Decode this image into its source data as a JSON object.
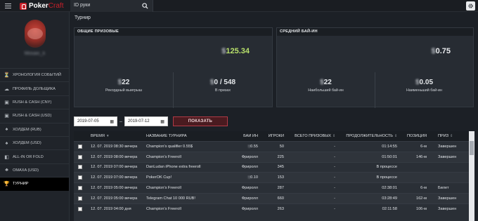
{
  "app": {
    "name_a": "Poker",
    "name_b": "Craft"
  },
  "search": {
    "value": "ID руки"
  },
  "user": {
    "name": "Mosaic_k"
  },
  "sidebar": {
    "items": [
      {
        "label": "ХРОНОЛОГИЯ СОБЫТИЙ",
        "icon": "timeline-icon"
      },
      {
        "label": "ПРОФИЛЬ ДОЛЬЩИКА",
        "icon": "cloud-icon"
      },
      {
        "label": "RUSH & CASH (CNY)",
        "icon": "rush-icon"
      },
      {
        "label": "RUSH & CASH (USD)",
        "icon": "rush-icon"
      },
      {
        "label": "ХОЛДЕМ (RUB)",
        "icon": "cards-icon"
      },
      {
        "label": "ХОЛДЕМ (USD)",
        "icon": "cards-icon"
      },
      {
        "label": "ALL-IN OR FOLD",
        "icon": "allin-icon"
      },
      {
        "label": "OMAXA (USD)",
        "icon": "omaha-icon"
      },
      {
        "label": "ТУРНИР",
        "icon": "trophy-icon"
      }
    ]
  },
  "page": {
    "title": "Турнир"
  },
  "prize_panel": {
    "title": "ОБЩИЕ ПРИЗОВЫЕ",
    "value": "125.34",
    "stats": [
      {
        "value": "22",
        "label": "Рекордный выигрыш"
      },
      {
        "value": "0 / 548",
        "label": "В призах"
      }
    ]
  },
  "buyin_panel": {
    "title": "СРЕДНИЙ БАЙ-ИН",
    "value": "0.75",
    "stats": [
      {
        "value": "22",
        "label": "Наибольший бай-ин"
      },
      {
        "value": "0.05",
        "label": "Наименьший бай-ин"
      }
    ]
  },
  "filters": {
    "date_from": "2019-07-05",
    "date_to": "2019-07-12",
    "separator": "–",
    "show_label": "ПОКАЗАТЬ"
  },
  "table": {
    "headers": {
      "time": "ВРЕМЯ",
      "name": "НАЗВАНИЕ ТУРНИРА",
      "buyin": "БАЙ ИН",
      "games": "ИГРОКИ",
      "total": "ВСЕГО ПРИЗОВЫХ",
      "duration": "ПРОДОЛЖИТЕЛЬНОСТЬ",
      "position": "ПОЗИЦИЯ",
      "prize": "ПРИЗ"
    },
    "rows": [
      {
        "time": "12. 07. 2019 08:30 вечера",
        "name": "Champion's qualifier 0.55$",
        "buyin": "0.55",
        "players": "50",
        "total": "-",
        "duration": "01:14:55",
        "position": "6-м",
        "prize": "Завершен"
      },
      {
        "time": "12. 07. 2019 08:00 вечера",
        "name": "Champion's Freeroll",
        "buyin": "Фриролл",
        "players": "225",
        "total": "-",
        "duration": "01:50:01",
        "position": "146-м",
        "prize": "Завершен"
      },
      {
        "time": "12. 07. 2019 07:00 вечера",
        "name": "DanLudan iPhone extra freeroll",
        "buyin": "Фриролл",
        "players": "345",
        "total": "-",
        "duration": "В процессе",
        "position": "",
        "prize": ""
      },
      {
        "time": "12. 07. 2019 07:00 вечера",
        "name": "PokerOK Cup!",
        "buyin": "0.10",
        "players": "153",
        "total": "-",
        "duration": "В процессе",
        "position": "",
        "prize": ""
      },
      {
        "time": "12. 07. 2019 05:00 вечера",
        "name": "Champion's Freeroll",
        "buyin": "Фриролл",
        "players": "287",
        "total": "-",
        "duration": "02:38:01",
        "position": "6-м",
        "prize": "Билет"
      },
      {
        "time": "12. 07. 2019 05:00 вечера",
        "name": "Telegram Chat 10 000 RUB!",
        "buyin": "Фриролл",
        "players": "660",
        "total": "-",
        "duration": "03:28:49",
        "position": "162-м",
        "prize": "Завершен"
      },
      {
        "time": "12. 07. 2019 04:00 дня",
        "name": "Champion's Freeroll",
        "buyin": "Фриролл",
        "players": "263",
        "total": "-",
        "duration": "02:11:58",
        "position": "106-м",
        "prize": "Завершен"
      }
    ]
  }
}
